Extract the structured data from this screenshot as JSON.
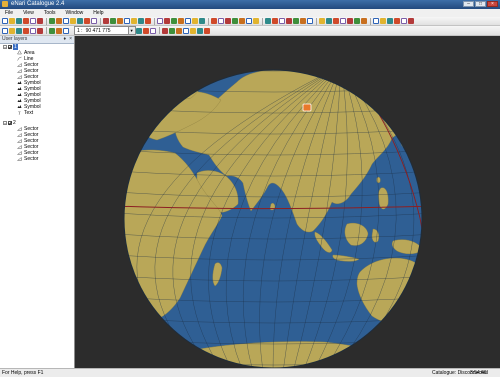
{
  "window": {
    "title": "eNari Catalogue 2.4"
  },
  "menu": [
    "File",
    "View",
    "Tools",
    "Window",
    "Help"
  ],
  "toolbar": {
    "scale_label": "1 :",
    "scale_value": "90 471 775",
    "icon_colors": [
      "#2f64b7",
      "#d04a2a",
      "#3f8f3b",
      "#e1b42f",
      "#7b5ea8",
      "#c86f1f",
      "#2e8a8a",
      "#b33a3a"
    ]
  },
  "panel": {
    "title": "User layers",
    "pin_glyph": "♦",
    "close_glyph": "×",
    "groups": [
      {
        "name": "1",
        "items": [
          {
            "icon": "area-icon",
            "label": "Area"
          },
          {
            "icon": "line-icon",
            "label": "Line"
          },
          {
            "icon": "sector-icon",
            "label": "Sector"
          },
          {
            "icon": "sector-icon",
            "label": "Sector"
          },
          {
            "icon": "sector-icon",
            "label": "Sector"
          },
          {
            "icon": "symbol-icon",
            "label": "Symbol"
          },
          {
            "icon": "symbol-icon",
            "label": "Symbol"
          },
          {
            "icon": "symbol-icon",
            "label": "Symbol"
          },
          {
            "icon": "symbol-icon",
            "label": "Symbol"
          },
          {
            "icon": "symbol-icon",
            "label": "Symbol"
          },
          {
            "icon": "text-icon",
            "label": "Text"
          }
        ]
      },
      {
        "name": "2",
        "items": [
          {
            "icon": "sector-icon",
            "label": "Sector"
          },
          {
            "icon": "sector-icon",
            "label": "Sector"
          },
          {
            "icon": "sector-icon",
            "label": "Sector"
          },
          {
            "icon": "sector-icon",
            "label": "Sector"
          },
          {
            "icon": "sector-icon",
            "label": "Sector"
          },
          {
            "icon": "sector-icon",
            "label": "Sector"
          }
        ]
      }
    ]
  },
  "map": {
    "colors": {
      "ocean": "#2f5f94",
      "land": "#b9a758",
      "grid": "#1c2f44",
      "equator": "#8c1f22",
      "background": "#2c2c2c",
      "marker": "#e8782a"
    }
  },
  "status": {
    "help": "For Help, press F1",
    "catalogue": "Catalogue: Disconnected",
    "time": "3:54:46"
  }
}
